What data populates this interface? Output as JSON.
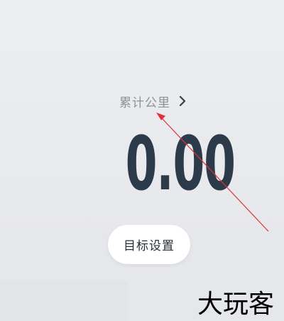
{
  "stat": {
    "label": "累计公里",
    "value": "0.00"
  },
  "goal_button": {
    "label": "目标设置"
  },
  "icons": {
    "stat_chevron": "chevron-right-icon"
  },
  "colors": {
    "background": "#e8e9ed",
    "value_text": "#2d3a4a",
    "label_text": "#8c9197",
    "button_bg": "#ffffff",
    "annotation": "#e0303a"
  },
  "watermark": {
    "text": "大玩客"
  }
}
